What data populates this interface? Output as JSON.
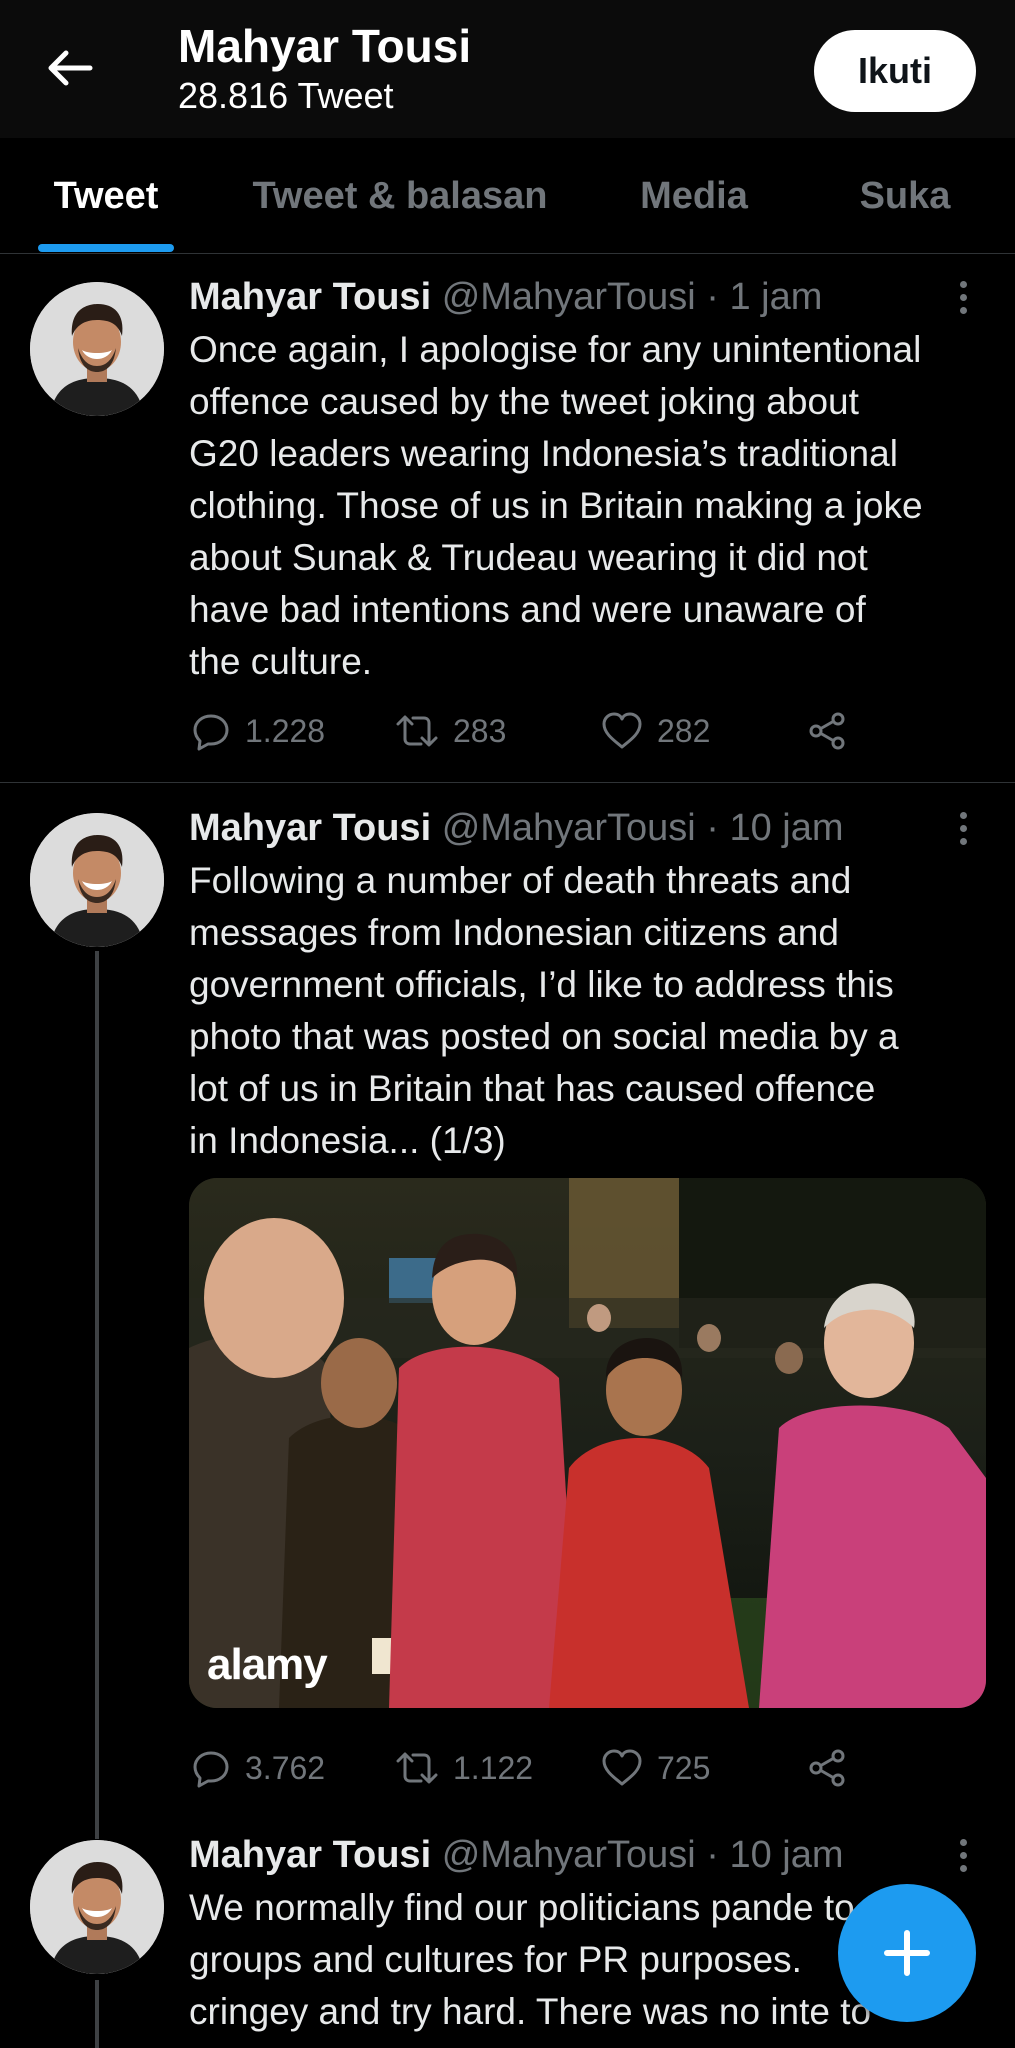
{
  "header": {
    "name": "Mahyar Tousi",
    "tweet_count": "28.816 Tweet",
    "follow_label": "Ikuti"
  },
  "tabs": [
    {
      "label": "Tweet",
      "active": true
    },
    {
      "label": "Tweet & balasan",
      "active": false
    },
    {
      "label": "Media",
      "active": false
    },
    {
      "label": "Suka",
      "active": false
    }
  ],
  "tweets": [
    {
      "name": "Mahyar Tousi",
      "handle": "@MahyarTousi",
      "time": "· 1 jam",
      "text": "Once again, I apologise for any unintentional\noffence caused by the tweet joking about\nG20 leaders wearing Indonesia’s traditional\nclothing. Those of us in Britain making a joke\nabout Sunak & Trudeau wearing it did not\nhave bad intentions and were unaware of\nthe culture.",
      "replies": "1.228",
      "retweets": "283",
      "likes": "282"
    },
    {
      "name": "Mahyar Tousi",
      "handle": "@MahyarTousi",
      "time": "· 10 jam",
      "text": "Following a number of death threats and\nmessages from Indonesian citizens and\ngovernment officials, I’d like to address this\nphoto that was posted on social media by a\nlot of us in Britain that has caused offence\nin Indonesia... (1/3)",
      "media_watermark": "alamy",
      "replies": "3.762",
      "retweets": "1.122",
      "likes": "725"
    },
    {
      "name": "Mahyar Tousi",
      "handle": "@MahyarTousi",
      "time": "· 10 jam",
      "text": "We normally find our politicians pande      to\ngroups and cultures for PR purposes.\ncringey and try hard. There was no inte     to"
    }
  ],
  "colors": {
    "accent": "#1d9bf0",
    "background": "#000000",
    "secondary_text": "#71767b"
  },
  "icons": {
    "back": "arrow-left-icon",
    "reply": "reply-bubble-icon",
    "retweet": "retweet-icon",
    "like": "heart-icon",
    "share": "share-icon",
    "more": "more-vertical-icon",
    "compose": "plus-icon"
  }
}
